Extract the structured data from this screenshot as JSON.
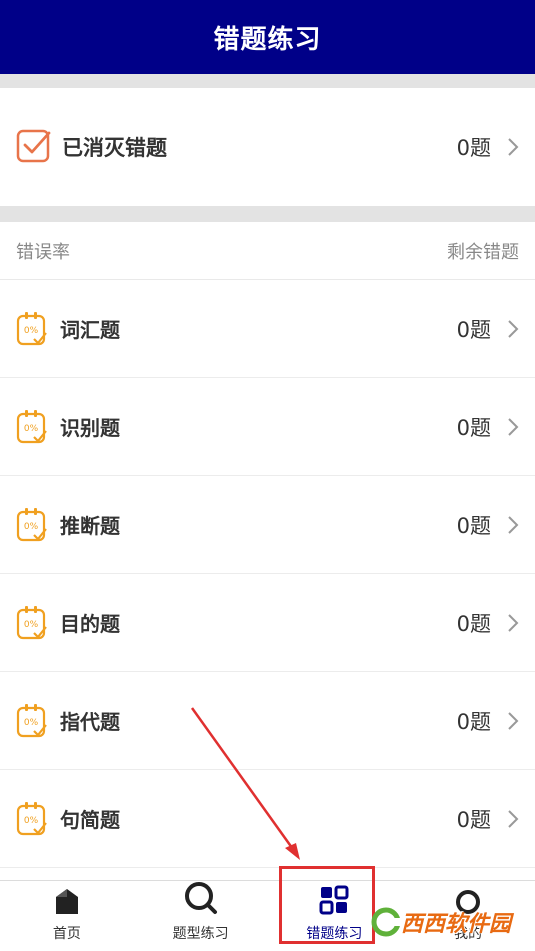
{
  "header": {
    "title": "错题练习"
  },
  "killed": {
    "label": "已消灭错题",
    "count": "0题"
  },
  "section": {
    "left_label": "错误率",
    "right_label": "剩余错题"
  },
  "rows": [
    {
      "icon_text": "0%",
      "label": "词汇题",
      "count": "0题"
    },
    {
      "icon_text": "0%",
      "label": "识别题",
      "count": "0题"
    },
    {
      "icon_text": "0%",
      "label": "推断题",
      "count": "0题"
    },
    {
      "icon_text": "0%",
      "label": "目的题",
      "count": "0题"
    },
    {
      "icon_text": "0%",
      "label": "指代题",
      "count": "0题"
    },
    {
      "icon_text": "0%",
      "label": "句简题",
      "count": "0题"
    }
  ],
  "tabs": [
    {
      "label": "首页",
      "icon": "home-icon"
    },
    {
      "label": "题型练习",
      "icon": "search-icon"
    },
    {
      "label": "错题练习",
      "icon": "grid-icon"
    },
    {
      "label": "我的",
      "icon": "profile-icon"
    }
  ],
  "watermark": {
    "text": "西西软件园"
  },
  "colors": {
    "header_bg": "#000088",
    "accent_orange": "#f0a020",
    "check_orange": "#e8744a",
    "annotation_red": "#e03030"
  }
}
